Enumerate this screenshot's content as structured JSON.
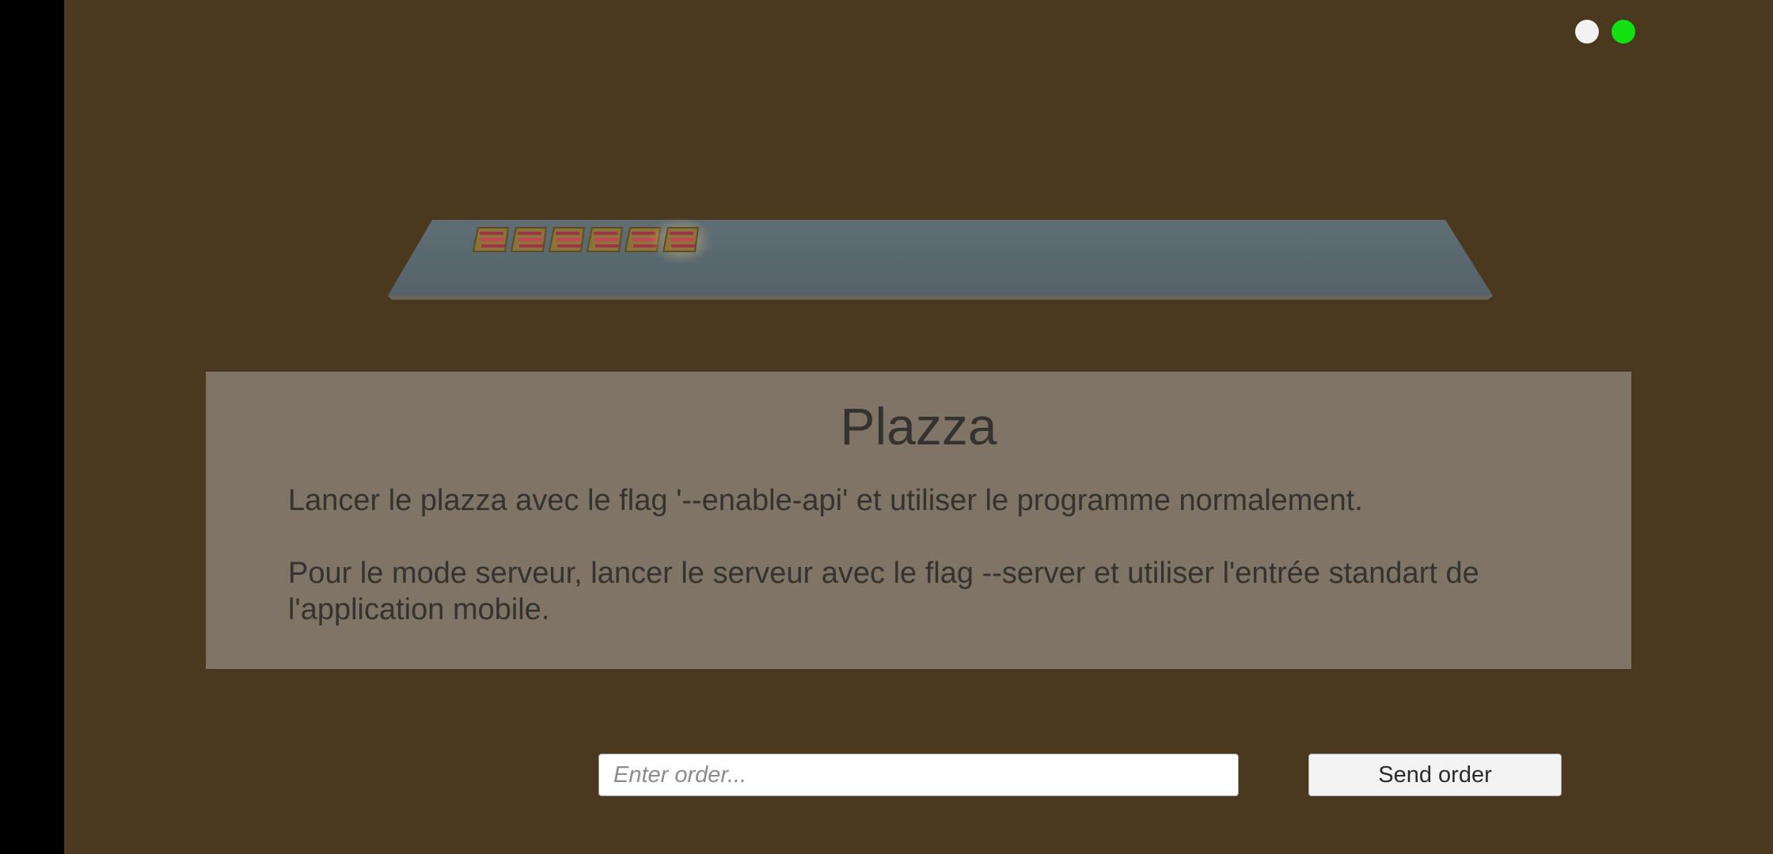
{
  "panel": {
    "title": "Plazza",
    "paragraph1": "Lancer le plazza avec le flag '--enable-api' et utiliser le programme normalement.",
    "paragraph2": "Pour le mode serveur, lancer le serveur avec le flag --server et utiliser l'entrée standart de l'application mobile."
  },
  "order": {
    "placeholder": "Enter order...",
    "value": "",
    "send_label": "Send order"
  },
  "status": {
    "indicator1_color": "#f2f2f2",
    "indicator2_color": "#12e212"
  },
  "scene": {
    "tray_color": "#5a6870",
    "cook_count": 6
  }
}
